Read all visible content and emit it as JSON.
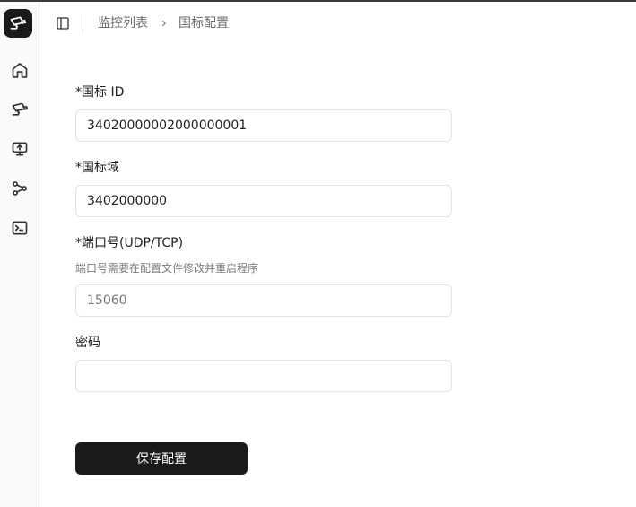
{
  "breadcrumb": {
    "parent": "监控列表",
    "current": "国标配置"
  },
  "sidebar": {
    "logo_icon": "camera-icon",
    "items": [
      {
        "name": "home",
        "icon": "home-icon"
      },
      {
        "name": "cameras",
        "icon": "camera-icon"
      },
      {
        "name": "screen",
        "icon": "monitor-icon"
      },
      {
        "name": "network",
        "icon": "network-icon"
      },
      {
        "name": "terminal",
        "icon": "terminal-icon"
      }
    ]
  },
  "form": {
    "gb_id": {
      "label": "*国标 ID",
      "value": "34020000002000000001"
    },
    "gb_domain": {
      "label": "*国标域",
      "value": "3402000000"
    },
    "port": {
      "label": "*端口号(UDP/TCP)",
      "hint": "端口号需要在配置文件修改并重启程序",
      "placeholder": "15060"
    },
    "password": {
      "label": "密码",
      "value": ""
    },
    "save_label": "保存配置"
  },
  "colors": {
    "primary": "#1a1a1a",
    "border": "#e3e3e3",
    "muted_text": "#6b6b6b"
  }
}
